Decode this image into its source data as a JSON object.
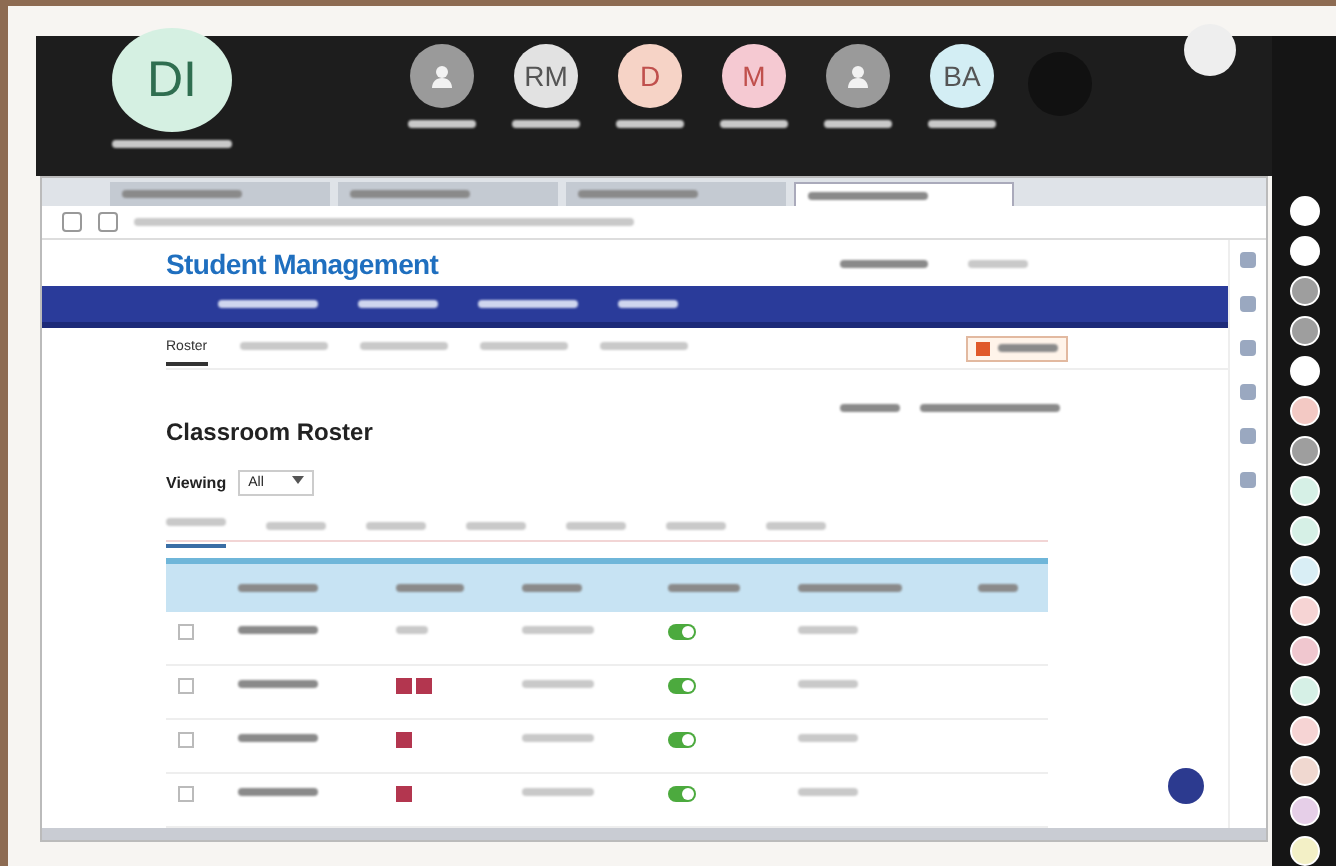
{
  "call": {
    "speaker": {
      "initials": "DI"
    },
    "participants": [
      {
        "kind": "icon",
        "color": "#9a9a9a"
      },
      {
        "kind": "initials",
        "initials": "RM",
        "color": "#e2e2e2"
      },
      {
        "kind": "initials",
        "initials": "D",
        "color": "#f6d3c6"
      },
      {
        "kind": "initials",
        "initials": "M",
        "color": "#f5c9d2"
      },
      {
        "kind": "icon",
        "color": "#9a9a9a"
      },
      {
        "kind": "initials",
        "initials": "BA",
        "color": "#d3eef4"
      }
    ]
  },
  "browser": {
    "tabs": [
      {
        "selected": false
      },
      {
        "selected": false
      },
      {
        "selected": false
      },
      {
        "selected": true
      }
    ],
    "site": {
      "title": "Student Management",
      "subtabs": [
        {
          "label": "Roster",
          "selected": true
        },
        {
          "selected": false
        },
        {
          "selected": false
        },
        {
          "selected": false
        },
        {
          "selected": false
        }
      ],
      "heading": "Classroom Roster",
      "viewing": {
        "label": "Viewing",
        "value": "All"
      },
      "tabs": [
        {
          "selected": true
        },
        {
          "selected": false
        },
        {
          "selected": false
        },
        {
          "selected": false
        },
        {
          "selected": false
        },
        {
          "selected": false
        },
        {
          "selected": false
        }
      ],
      "rows": [
        {
          "checked": false,
          "enabled": true
        },
        {
          "checked": false,
          "passwords": [
            {
              "kind": "card"
            },
            {
              "kind": "card"
            }
          ],
          "enabled": true
        },
        {
          "checked": false,
          "passwords": [
            {
              "kind": "card"
            }
          ],
          "enabled": true
        },
        {
          "checked": false,
          "passwords": [
            {
              "kind": "card"
            }
          ],
          "enabled": true
        }
      ]
    }
  },
  "rail": {
    "avatars": [
      {
        "color": "#ffffff"
      },
      {
        "color": "#ffffff"
      },
      {
        "color": "#9e9e9e"
      },
      {
        "color": "#9e9e9e"
      },
      {
        "color": "#ffffff"
      },
      {
        "color": "#f3c9c4"
      },
      {
        "color": "#9e9e9e"
      },
      {
        "color": "#d6f0e6"
      },
      {
        "color": "#d6f0e6"
      },
      {
        "color": "#d9eef5"
      },
      {
        "color": "#f6d4d4"
      },
      {
        "color": "#f0c7cf"
      },
      {
        "color": "#d6f0e6"
      },
      {
        "color": "#f6d4d4"
      },
      {
        "color": "#f0d8d0"
      },
      {
        "color": "#e6cfe8"
      },
      {
        "color": "#f3f0c6"
      }
    ]
  }
}
